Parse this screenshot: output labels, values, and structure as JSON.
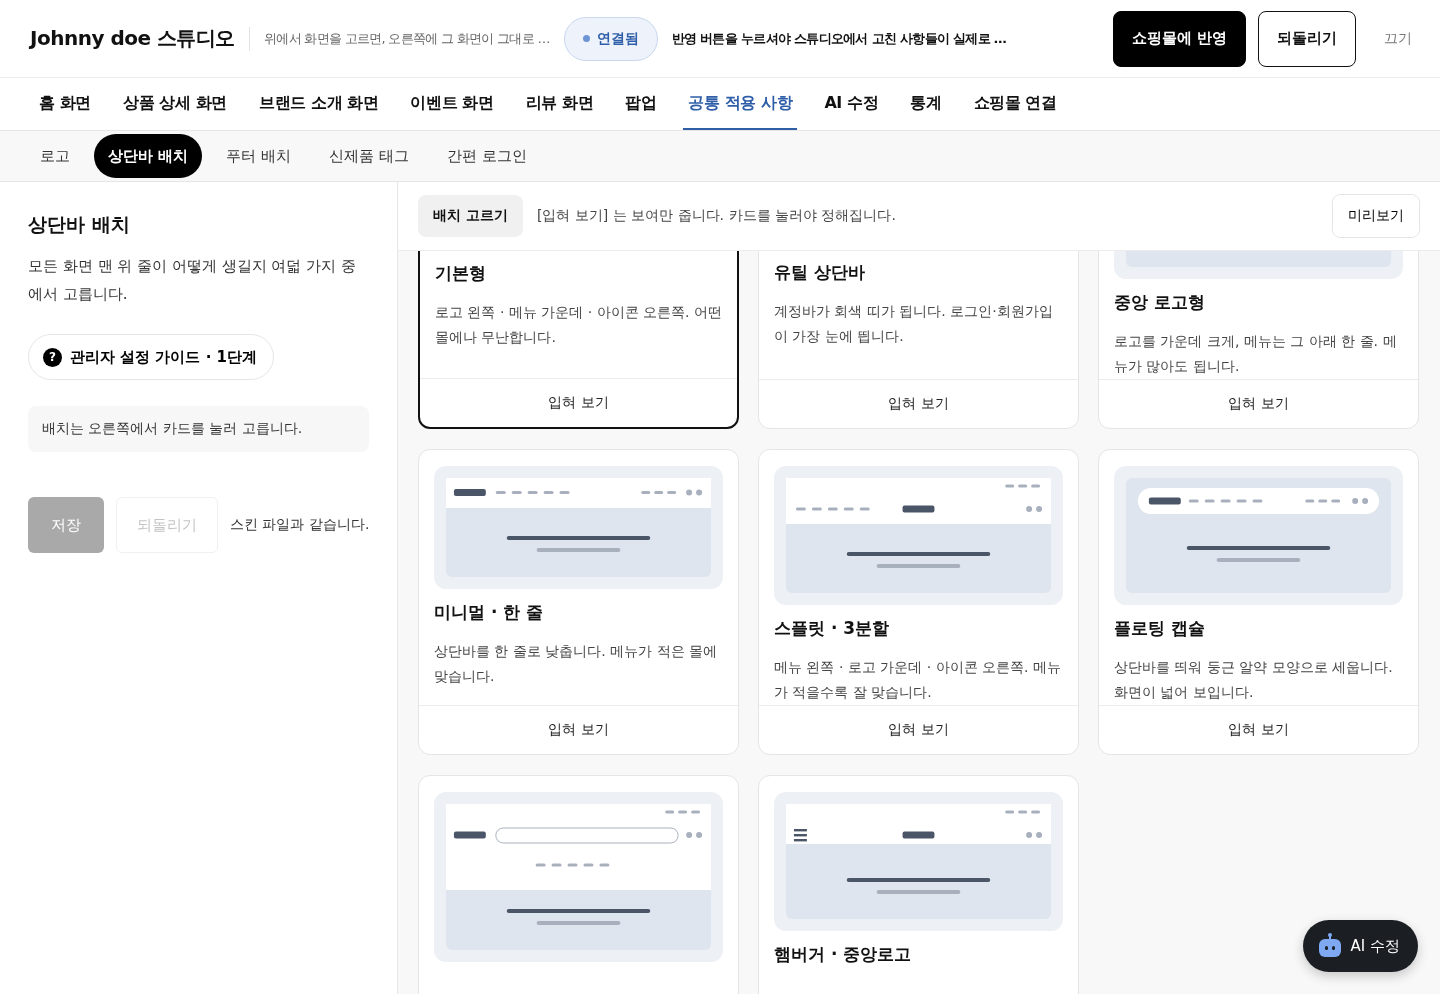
{
  "header": {
    "title": "Johnny doe 스튜디오",
    "hint": "위에서 화면을 고르면, 오른쪽에 그 화면이 그대로 …",
    "status": {
      "label": "연결됨",
      "connected": true
    },
    "notice": "반영 버튼을 누르셔야 스튜디오에서 고친 사항들이 실제로 …",
    "buttons": [
      {
        "label": "쇼핑몰에 반영",
        "kind": "primary"
      },
      {
        "label": "되돌리기",
        "kind": "outline"
      },
      {
        "label": "끄기",
        "kind": "text"
      }
    ]
  },
  "nav_tabs": [
    {
      "label": "홈 화면",
      "selected": false
    },
    {
      "label": "상품 상세 화면",
      "selected": false
    },
    {
      "label": "브랜드 소개 화면",
      "selected": false
    },
    {
      "label": "이벤트 화면",
      "selected": false
    },
    {
      "label": "리뷰 화면",
      "selected": false
    },
    {
      "label": "팝업",
      "selected": false
    },
    {
      "label": "공통 적용 사항",
      "selected": true
    },
    {
      "label": "AI 수정",
      "selected": false
    },
    {
      "label": "통계",
      "selected": false
    },
    {
      "label": "쇼핑몰 연결",
      "selected": false
    }
  ],
  "sub_tabs": [
    {
      "label": "로고",
      "selected": false
    },
    {
      "label": "상단바 배치",
      "selected": true
    },
    {
      "label": "푸터 배치",
      "selected": false
    },
    {
      "label": "신제품 태그",
      "selected": false
    },
    {
      "label": "간편 로그인",
      "selected": false
    }
  ],
  "side_panel": {
    "title": "상단바 배치",
    "description": "모든 화면 맨 위 줄이 어떻게 생길지 여덟 가지 중에서 고릅니다.",
    "guide": {
      "icon": "?",
      "label": "관리자 설정 가이드 · 1단계"
    },
    "info": "배치는 오른쪽에서 카드를 눌러 고릅니다.",
    "save_button": {
      "label": "저장",
      "disabled": true
    },
    "revert_button": {
      "label": "되돌리기",
      "disabled": true
    },
    "status": "스킨 파일과 같습니다."
  },
  "layout_picker": {
    "label": "배치 고르기",
    "hint": "[입혀 보기] 는 보여만 줍니다. 카드를 눌러야 정해집니다.",
    "preview_button": "미리보기",
    "cards": [
      {
        "title": "기본형",
        "description": "로고 왼쪽 · 메뉴 가운데 · 아이콘 오른쪽. 어떤 몰에나 무난합니다.",
        "action": "입혀 보기",
        "selected": true
      },
      {
        "title": "유틸 상단바",
        "description": "계정바가 회색 띠가 됩니다. 로그인·회원가입이 가장 눈에 띕니다.",
        "action": "입혀 보기",
        "selected": false
      },
      {
        "kind": "center-logo",
        "title": "중앙 로고형",
        "description": "로고를 가운데 크게, 메뉴는 그 아래 한 줄. 메뉴가 많아도 됩니다.",
        "action": "입혀 보기",
        "selected": false
      },
      {
        "kind": "minimal",
        "title": "미니멀 · 한 줄",
        "description": "상단바를 한 줄로 낮춥니다. 메뉴가 적은 몰에 맞습니다.",
        "action": "입혀 보기",
        "selected": false
      },
      {
        "kind": "split",
        "title": "스플릿 · 3분할",
        "description": "메뉴 왼쪽 · 로고 가운데 · 아이콘 오른쪽. 메뉴가 적을수록 잘 맞습니다.",
        "action": "입혀 보기",
        "selected": false
      },
      {
        "kind": "floating",
        "title": "플로팅 캡슐",
        "description": "상단바를 띄워 둥근 알약 모양으로 세웁니다. 화면이 넓어 보입니다.",
        "action": "입혀 보기",
        "selected": false
      },
      {
        "kind": "search",
        "selected": false
      },
      {
        "kind": "hamburger",
        "title": "햄버거 · 중앙로고",
        "selected": false
      }
    ]
  },
  "ai_button": {
    "label": "AI 수정"
  }
}
